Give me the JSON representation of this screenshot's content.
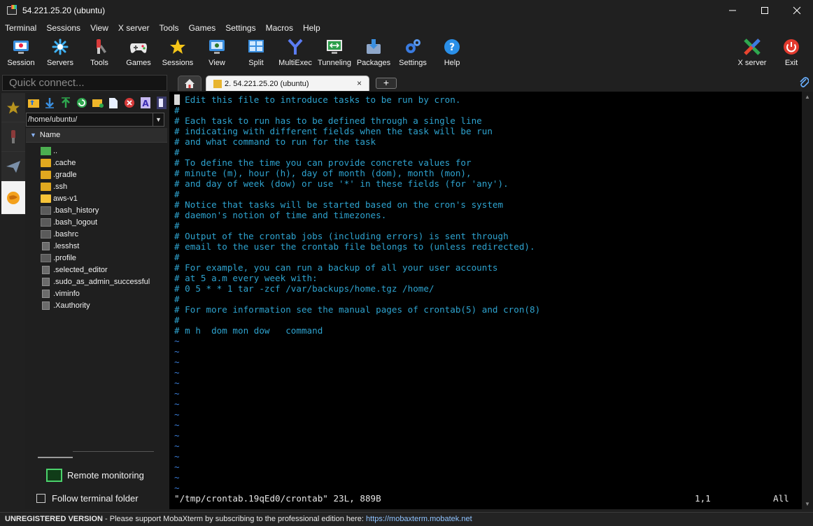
{
  "window": {
    "title": "54.221.25.20 (ubuntu)"
  },
  "menu": [
    "Terminal",
    "Sessions",
    "View",
    "X server",
    "Tools",
    "Games",
    "Settings",
    "Macros",
    "Help"
  ],
  "toolbar": [
    {
      "label": "Session",
      "icon": "session-icon"
    },
    {
      "label": "Servers",
      "icon": "servers-icon"
    },
    {
      "label": "Tools",
      "icon": "tools-icon"
    },
    {
      "label": "Games",
      "icon": "games-icon"
    },
    {
      "label": "Sessions",
      "icon": "star-icon"
    },
    {
      "label": "View",
      "icon": "view-icon"
    },
    {
      "label": "Split",
      "icon": "split-icon"
    },
    {
      "label": "MultiExec",
      "icon": "multiexec-icon"
    },
    {
      "label": "Tunneling",
      "icon": "tunneling-icon"
    },
    {
      "label": "Packages",
      "icon": "packages-icon"
    },
    {
      "label": "Settings",
      "icon": "gear-icon"
    },
    {
      "label": "Help",
      "icon": "help-icon"
    }
  ],
  "toolbar_right": [
    {
      "label": "X server",
      "icon": "x-server-icon"
    },
    {
      "label": "Exit",
      "icon": "power-icon"
    }
  ],
  "quick_connect": {
    "placeholder": "Quick connect..."
  },
  "sftp": {
    "path": "/home/ubuntu/",
    "column_header": "Name",
    "files": [
      {
        "name": "..",
        "kind": "up"
      },
      {
        "name": ".cache",
        "kind": "folder"
      },
      {
        "name": ".gradle",
        "kind": "folder"
      },
      {
        "name": ".ssh",
        "kind": "folder"
      },
      {
        "name": "aws-v1",
        "kind": "folder-open"
      },
      {
        "name": ".bash_history",
        "kind": "doc"
      },
      {
        "name": ".bash_logout",
        "kind": "doc"
      },
      {
        "name": ".bashrc",
        "kind": "doc"
      },
      {
        "name": ".lesshst",
        "kind": "txt"
      },
      {
        "name": ".profile",
        "kind": "doc"
      },
      {
        "name": ".selected_editor",
        "kind": "txt"
      },
      {
        "name": ".sudo_as_admin_successful",
        "kind": "txt"
      },
      {
        "name": ".viminfo",
        "kind": "txt"
      },
      {
        "name": ".Xauthority",
        "kind": "txt"
      }
    ],
    "remote_monitoring": "Remote monitoring",
    "follow_terminal": "Follow terminal folder"
  },
  "tabs": {
    "active_label": "2. 54.221.25.20 (ubuntu)",
    "close": "×",
    "add": "+"
  },
  "terminal": {
    "lines": [
      "# Edit this file to introduce tasks to be run by cron.",
      "#",
      "# Each task to run has to be defined through a single line",
      "# indicating with different fields when the task will be run",
      "# and what command to run for the task",
      "#",
      "# To define the time you can provide concrete values for",
      "# minute (m), hour (h), day of month (dom), month (mon),",
      "# and day of week (dow) or use '*' in these fields (for 'any').",
      "#",
      "# Notice that tasks will be started based on the cron's system",
      "# daemon's notion of time and timezones.",
      "#",
      "# Output of the crontab jobs (including errors) is sent through",
      "# email to the user the crontab file belongs to (unless redirected).",
      "#",
      "# For example, you can run a backup of all your user accounts",
      "# at 5 a.m every week with:",
      "# 0 5 * * 1 tar -zcf /var/backups/home.tgz /home/",
      "#",
      "# For more information see the manual pages of crontab(5) and cron(8)",
      "#",
      "# m h  dom mon dow   command"
    ],
    "tilde": "~",
    "status_file": "\"/tmp/crontab.19qEd0/crontab\" 23L, 889B",
    "status_pos": "1,1",
    "status_all": "All"
  },
  "statusbar": {
    "unregistered": "UNREGISTERED VERSION",
    "message": " -  Please support MobaXterm by subscribing to the professional edition here: ",
    "url": "https://mobaxterm.mobatek.net"
  }
}
